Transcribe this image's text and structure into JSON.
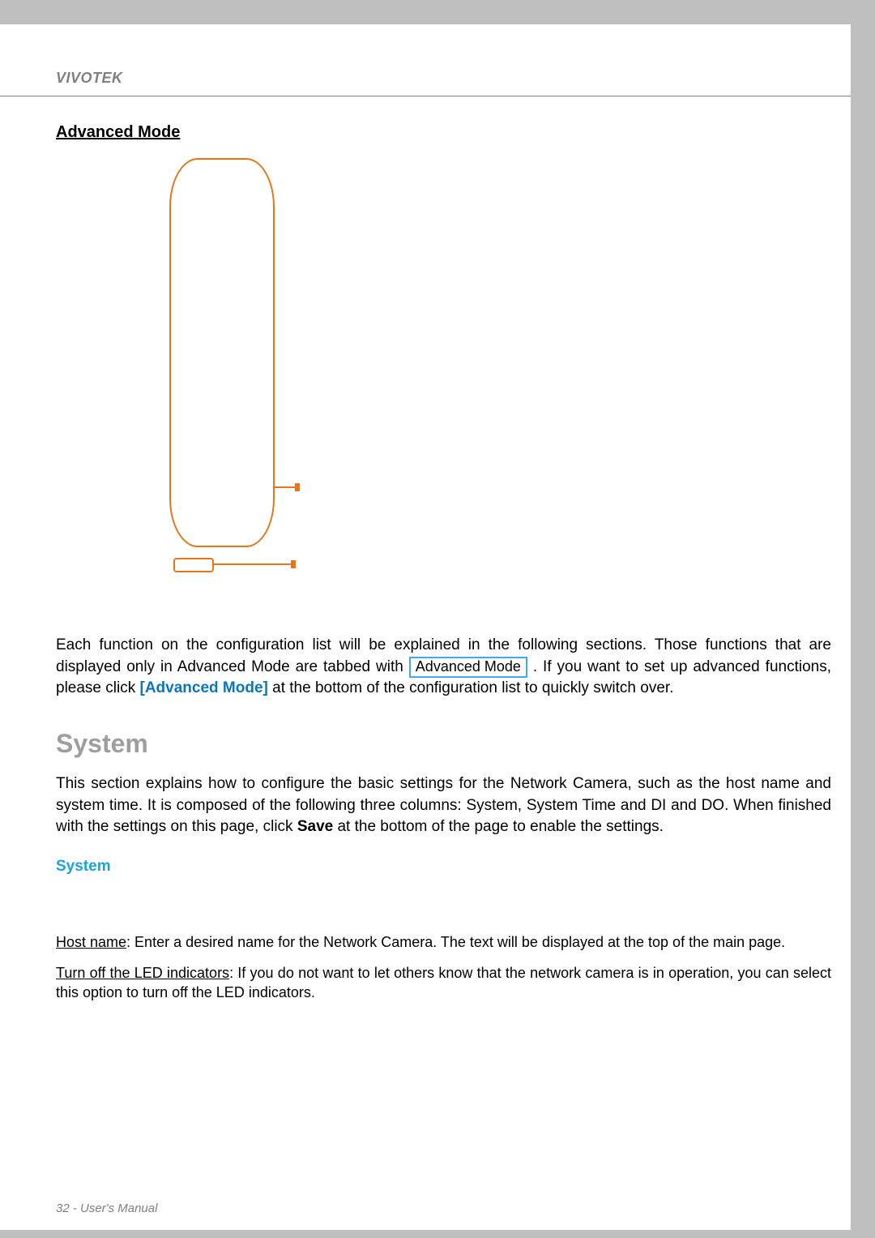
{
  "header": {
    "brand": "VIVOTEK"
  },
  "section": {
    "heading": "Advanced Mode",
    "intro": {
      "part1": "Each function on the configuration list will be explained in the following sections. Those functions that are displayed only in Advanced Mode are tabbed with ",
      "tag": "Advanced Mode",
      "part2a": " . If you want to set up advanced functions, please click ",
      "linkText": "[Advanced Mode]",
      "part2b": " at the bottom of the configuration list to quickly switch over."
    }
  },
  "system": {
    "title": "System",
    "paragraph": {
      "part1": "This section explains how to configure the basic settings for the Network Camera, such as the host name and system time. It is composed of the following three columns: System, System Time and DI and DO. When finished with the settings on this page, click ",
      "saveWord": "Save",
      "part2": " at the bottom of the page to enable the settings."
    },
    "subheading": "System",
    "hostName": {
      "label": "Host name",
      "text": ": Enter a desired name for the Network Camera. The text will be displayed at the top of the main page."
    },
    "led": {
      "label": "Turn off the LED indicators",
      "text": ": If you do not want to let others know that the network camera is in operation, you can select this option to turn off the LED indicators."
    }
  },
  "footer": {
    "page": "32",
    "sep": " - ",
    "title": "User's Manual"
  }
}
